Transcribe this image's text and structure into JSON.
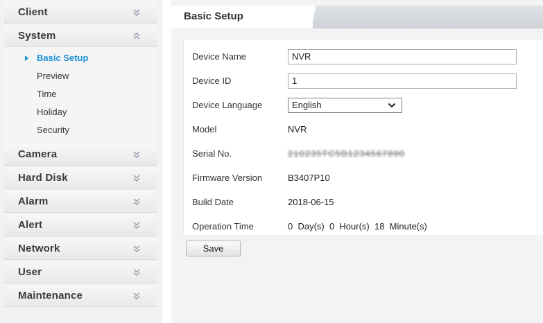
{
  "sidebar": {
    "sections": [
      {
        "label": "Client",
        "chevron": "chevron-double-down-icon"
      },
      {
        "label": "System",
        "chevron": "chevron-double-up-icon",
        "items": [
          "Basic Setup",
          "Preview",
          "Time",
          "Holiday",
          "Security"
        ],
        "active_item": "Basic Setup"
      },
      {
        "label": "Camera",
        "chevron": "chevron-double-down-icon"
      },
      {
        "label": "Hard Disk",
        "chevron": "chevron-double-down-icon"
      },
      {
        "label": "Alarm",
        "chevron": "chevron-double-down-icon"
      },
      {
        "label": "Alert",
        "chevron": "chevron-double-down-icon"
      },
      {
        "label": "Network",
        "chevron": "chevron-double-down-icon"
      },
      {
        "label": "User",
        "chevron": "chevron-double-down-icon"
      },
      {
        "label": "Maintenance",
        "chevron": "chevron-double-down-icon"
      }
    ]
  },
  "tab": {
    "label": "Basic Setup"
  },
  "form": {
    "device_name": {
      "label": "Device Name",
      "value": "NVR"
    },
    "device_id": {
      "label": "Device ID",
      "value": "1"
    },
    "device_language": {
      "label": "Device Language",
      "value": "English"
    },
    "model": {
      "label": "Model",
      "value": "NVR"
    },
    "serial_no": {
      "label": "Serial No.",
      "value": "210235TC5B1234567890"
    },
    "firmware_version": {
      "label": "Firmware Version",
      "value": "B3407P10"
    },
    "build_date": {
      "label": "Build Date",
      "value": "2018-06-15"
    },
    "operation_time": {
      "label": "Operation Time",
      "value": "0  Day(s)  0  Hour(s)  18  Minute(s)"
    }
  },
  "save_label": "Save",
  "colors": {
    "accent": "#1a8fd6",
    "sidebar_bg": "#f2f2f2",
    "tabbar": "#d8dbe0"
  }
}
